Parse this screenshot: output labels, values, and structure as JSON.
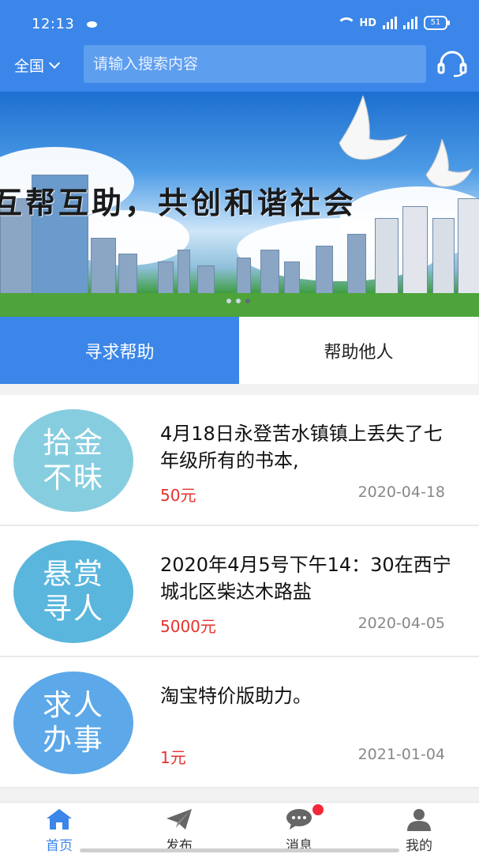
{
  "status_bar": {
    "time": "12:13",
    "hd": "HD",
    "battery": "51"
  },
  "header": {
    "location": "全国",
    "search_placeholder": "请输入搜索内容"
  },
  "banner": {
    "text": "互帮互助，共创和谐社会"
  },
  "tabs": [
    {
      "label": "寻求帮助",
      "active": true
    },
    {
      "label": "帮助他人",
      "active": false
    }
  ],
  "items": [
    {
      "badge_line1": "拾金",
      "badge_line2": "不昧",
      "title": "4月18日永登苦水镇镇上丢失了七年级所有的书本,",
      "price": "50元",
      "date": "2020-04-18"
    },
    {
      "badge_line1": "悬赏",
      "badge_line2": "寻人",
      "title": "2020年4月5号下午14：30在西宁城北区柴达木路盐",
      "price": "5000元",
      "date": "2020-04-05"
    },
    {
      "badge_line1": "求人",
      "badge_line2": "办事",
      "title": "淘宝特价版助力。",
      "price": "1元",
      "date": "2021-01-04"
    }
  ],
  "bottom_nav": [
    {
      "label": "首页",
      "icon": "home-icon",
      "active": true
    },
    {
      "label": "发布",
      "icon": "paper-plane-icon",
      "active": false
    },
    {
      "label": "消息",
      "icon": "chat-icon",
      "active": false
    },
    {
      "label": "我的",
      "icon": "user-icon",
      "active": false
    }
  ],
  "colors": {
    "primary": "#3b86e8",
    "price": "#e5322d",
    "badge": "#f2283a"
  }
}
